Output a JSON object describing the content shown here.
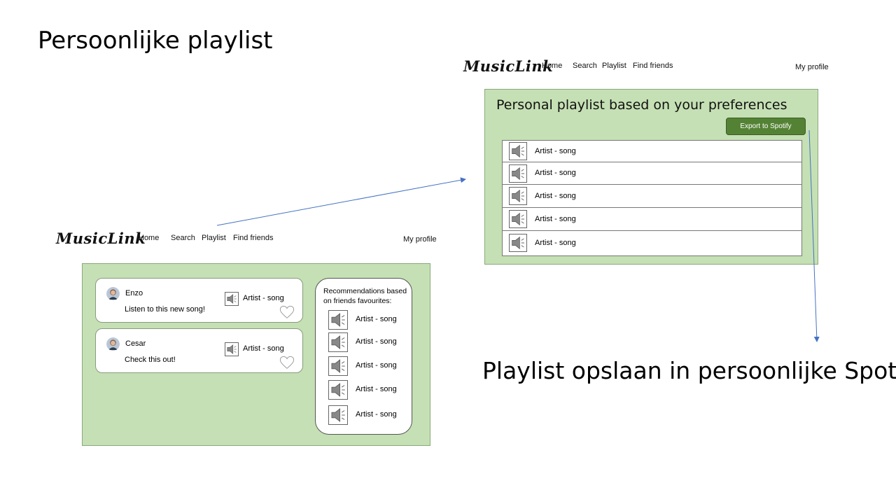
{
  "slide": {
    "title": "Persoonlijke playlist",
    "caption": "Playlist opslaan in persoonlijke Spotify"
  },
  "nav": {
    "logo": "MusicLink",
    "home": "Home",
    "search": "Search",
    "playlist": "Playlist",
    "find_friends": "Find friends",
    "my_profile": "My profile"
  },
  "feed": {
    "posts": [
      {
        "user": "Enzo",
        "message": "Listen to this new song!",
        "song": "Artist - song"
      },
      {
        "user": "Cesar",
        "message": "Check this out!",
        "song": "Artist - song"
      }
    ]
  },
  "recommendations": {
    "title": "Recommendations based on friends favourites:",
    "items": [
      "Artist - song",
      "Artist - song",
      "Artist - song",
      "Artist - song",
      "Artist - song"
    ]
  },
  "personal_playlist": {
    "heading": "Personal playlist based on your preferences",
    "export_button": "Export to Spotify",
    "songs": [
      "Artist - song",
      "Artist - song",
      "Artist - song",
      "Artist - song",
      "Artist - song"
    ]
  },
  "colors": {
    "panel_bg": "#c5e0b4",
    "button_bg": "#548235",
    "arrow": "#4472c4"
  },
  "icons": [
    "speaker-icon",
    "heart-icon",
    "avatar-icon"
  ]
}
